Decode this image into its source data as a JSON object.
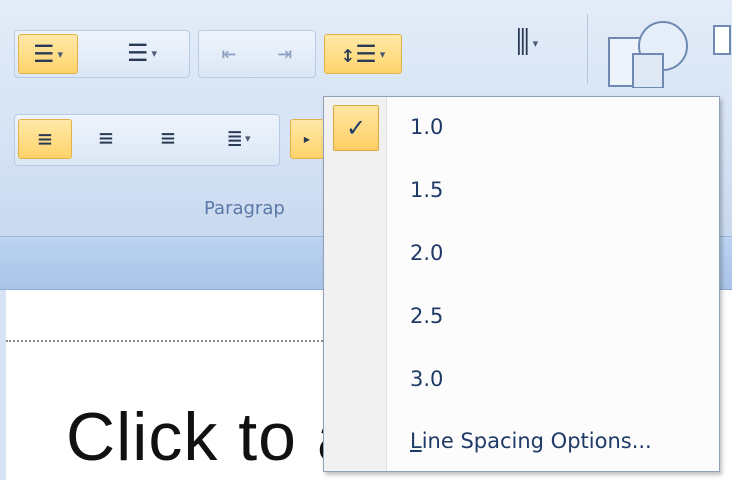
{
  "ribbon": {
    "group_label": "Paragrap",
    "buttons": {
      "bullets_icon": "bullets-list-icon",
      "numbering_icon": "numbered-list-icon",
      "decrease_indent_icon": "decrease-indent-icon",
      "increase_indent_icon": "increase-indent-icon",
      "line_spacing_icon": "line-spacing-icon",
      "text_direction_icon": "text-direction-icon",
      "align_left_icon": "align-left-icon",
      "center_icon": "align-center-icon",
      "align_right_icon": "align-right-icon",
      "justify_icon": "justify-icon"
    }
  },
  "slide": {
    "placeholder_text": "Click to add title"
  },
  "line_spacing_menu": {
    "items": [
      {
        "label": "1.0",
        "checked": true
      },
      {
        "label": "1.5",
        "checked": false
      },
      {
        "label": "2.0",
        "checked": false
      },
      {
        "label": "2.5",
        "checked": false
      },
      {
        "label": "3.0",
        "checked": false
      }
    ],
    "options_first_letter": "L",
    "options_rest": "ine Spacing Options...",
    "check_glyph": "✓"
  },
  "colors": {
    "accent_highlight": "#ffd36a",
    "menu_text": "#1f3a66",
    "ribbon_bg": "#d7e4f5"
  }
}
